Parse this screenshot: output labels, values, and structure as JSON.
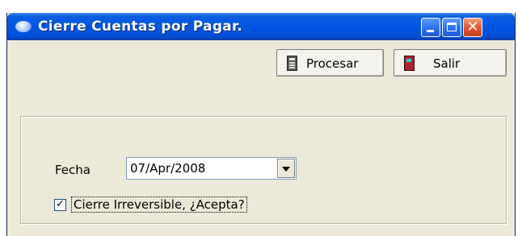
{
  "window": {
    "title": "Cierre Cuentas por Pagar.",
    "close_glyph": "✕"
  },
  "toolbar": {
    "procesar_label": "Procesar",
    "salir_label": "Salir"
  },
  "form": {
    "fecha_label": "Fecha",
    "fecha_value": "07/Apr/2008",
    "checkbox_checked": true,
    "checkbox_mark": "✓",
    "checkbox_label": "Cierre Irreversible, ¿Acepta?"
  },
  "icons": {
    "app": "app-icon",
    "procesar": "calculator-icon",
    "salir": "door-icon",
    "dropdown": "chevron-down-icon"
  }
}
